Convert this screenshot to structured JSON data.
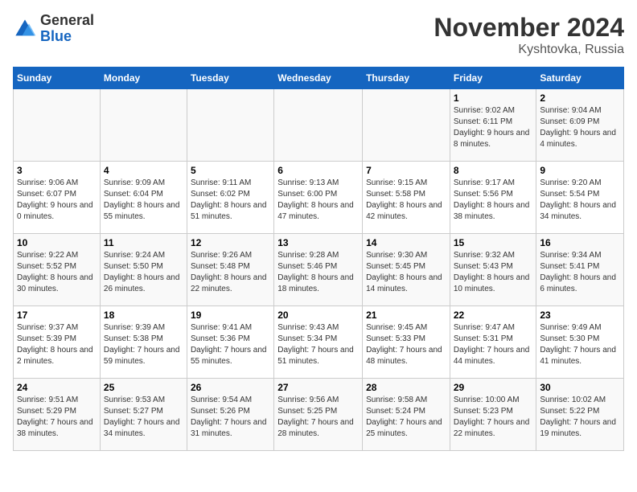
{
  "logo": {
    "general": "General",
    "blue": "Blue"
  },
  "title": {
    "month": "November 2024",
    "location": "Kyshtovka, Russia"
  },
  "headers": [
    "Sunday",
    "Monday",
    "Tuesday",
    "Wednesday",
    "Thursday",
    "Friday",
    "Saturday"
  ],
  "weeks": [
    [
      {
        "day": "",
        "info": ""
      },
      {
        "day": "",
        "info": ""
      },
      {
        "day": "",
        "info": ""
      },
      {
        "day": "",
        "info": ""
      },
      {
        "day": "",
        "info": ""
      },
      {
        "day": "1",
        "info": "Sunrise: 9:02 AM\nSunset: 6:11 PM\nDaylight: 9 hours and 8 minutes."
      },
      {
        "day": "2",
        "info": "Sunrise: 9:04 AM\nSunset: 6:09 PM\nDaylight: 9 hours and 4 minutes."
      }
    ],
    [
      {
        "day": "3",
        "info": "Sunrise: 9:06 AM\nSunset: 6:07 PM\nDaylight: 9 hours and 0 minutes."
      },
      {
        "day": "4",
        "info": "Sunrise: 9:09 AM\nSunset: 6:04 PM\nDaylight: 8 hours and 55 minutes."
      },
      {
        "day": "5",
        "info": "Sunrise: 9:11 AM\nSunset: 6:02 PM\nDaylight: 8 hours and 51 minutes."
      },
      {
        "day": "6",
        "info": "Sunrise: 9:13 AM\nSunset: 6:00 PM\nDaylight: 8 hours and 47 minutes."
      },
      {
        "day": "7",
        "info": "Sunrise: 9:15 AM\nSunset: 5:58 PM\nDaylight: 8 hours and 42 minutes."
      },
      {
        "day": "8",
        "info": "Sunrise: 9:17 AM\nSunset: 5:56 PM\nDaylight: 8 hours and 38 minutes."
      },
      {
        "day": "9",
        "info": "Sunrise: 9:20 AM\nSunset: 5:54 PM\nDaylight: 8 hours and 34 minutes."
      }
    ],
    [
      {
        "day": "10",
        "info": "Sunrise: 9:22 AM\nSunset: 5:52 PM\nDaylight: 8 hours and 30 minutes."
      },
      {
        "day": "11",
        "info": "Sunrise: 9:24 AM\nSunset: 5:50 PM\nDaylight: 8 hours and 26 minutes."
      },
      {
        "day": "12",
        "info": "Sunrise: 9:26 AM\nSunset: 5:48 PM\nDaylight: 8 hours and 22 minutes."
      },
      {
        "day": "13",
        "info": "Sunrise: 9:28 AM\nSunset: 5:46 PM\nDaylight: 8 hours and 18 minutes."
      },
      {
        "day": "14",
        "info": "Sunrise: 9:30 AM\nSunset: 5:45 PM\nDaylight: 8 hours and 14 minutes."
      },
      {
        "day": "15",
        "info": "Sunrise: 9:32 AM\nSunset: 5:43 PM\nDaylight: 8 hours and 10 minutes."
      },
      {
        "day": "16",
        "info": "Sunrise: 9:34 AM\nSunset: 5:41 PM\nDaylight: 8 hours and 6 minutes."
      }
    ],
    [
      {
        "day": "17",
        "info": "Sunrise: 9:37 AM\nSunset: 5:39 PM\nDaylight: 8 hours and 2 minutes."
      },
      {
        "day": "18",
        "info": "Sunrise: 9:39 AM\nSunset: 5:38 PM\nDaylight: 7 hours and 59 minutes."
      },
      {
        "day": "19",
        "info": "Sunrise: 9:41 AM\nSunset: 5:36 PM\nDaylight: 7 hours and 55 minutes."
      },
      {
        "day": "20",
        "info": "Sunrise: 9:43 AM\nSunset: 5:34 PM\nDaylight: 7 hours and 51 minutes."
      },
      {
        "day": "21",
        "info": "Sunrise: 9:45 AM\nSunset: 5:33 PM\nDaylight: 7 hours and 48 minutes."
      },
      {
        "day": "22",
        "info": "Sunrise: 9:47 AM\nSunset: 5:31 PM\nDaylight: 7 hours and 44 minutes."
      },
      {
        "day": "23",
        "info": "Sunrise: 9:49 AM\nSunset: 5:30 PM\nDaylight: 7 hours and 41 minutes."
      }
    ],
    [
      {
        "day": "24",
        "info": "Sunrise: 9:51 AM\nSunset: 5:29 PM\nDaylight: 7 hours and 38 minutes."
      },
      {
        "day": "25",
        "info": "Sunrise: 9:53 AM\nSunset: 5:27 PM\nDaylight: 7 hours and 34 minutes."
      },
      {
        "day": "26",
        "info": "Sunrise: 9:54 AM\nSunset: 5:26 PM\nDaylight: 7 hours and 31 minutes."
      },
      {
        "day": "27",
        "info": "Sunrise: 9:56 AM\nSunset: 5:25 PM\nDaylight: 7 hours and 28 minutes."
      },
      {
        "day": "28",
        "info": "Sunrise: 9:58 AM\nSunset: 5:24 PM\nDaylight: 7 hours and 25 minutes."
      },
      {
        "day": "29",
        "info": "Sunrise: 10:00 AM\nSunset: 5:23 PM\nDaylight: 7 hours and 22 minutes."
      },
      {
        "day": "30",
        "info": "Sunrise: 10:02 AM\nSunset: 5:22 PM\nDaylight: 7 hours and 19 minutes."
      }
    ]
  ]
}
